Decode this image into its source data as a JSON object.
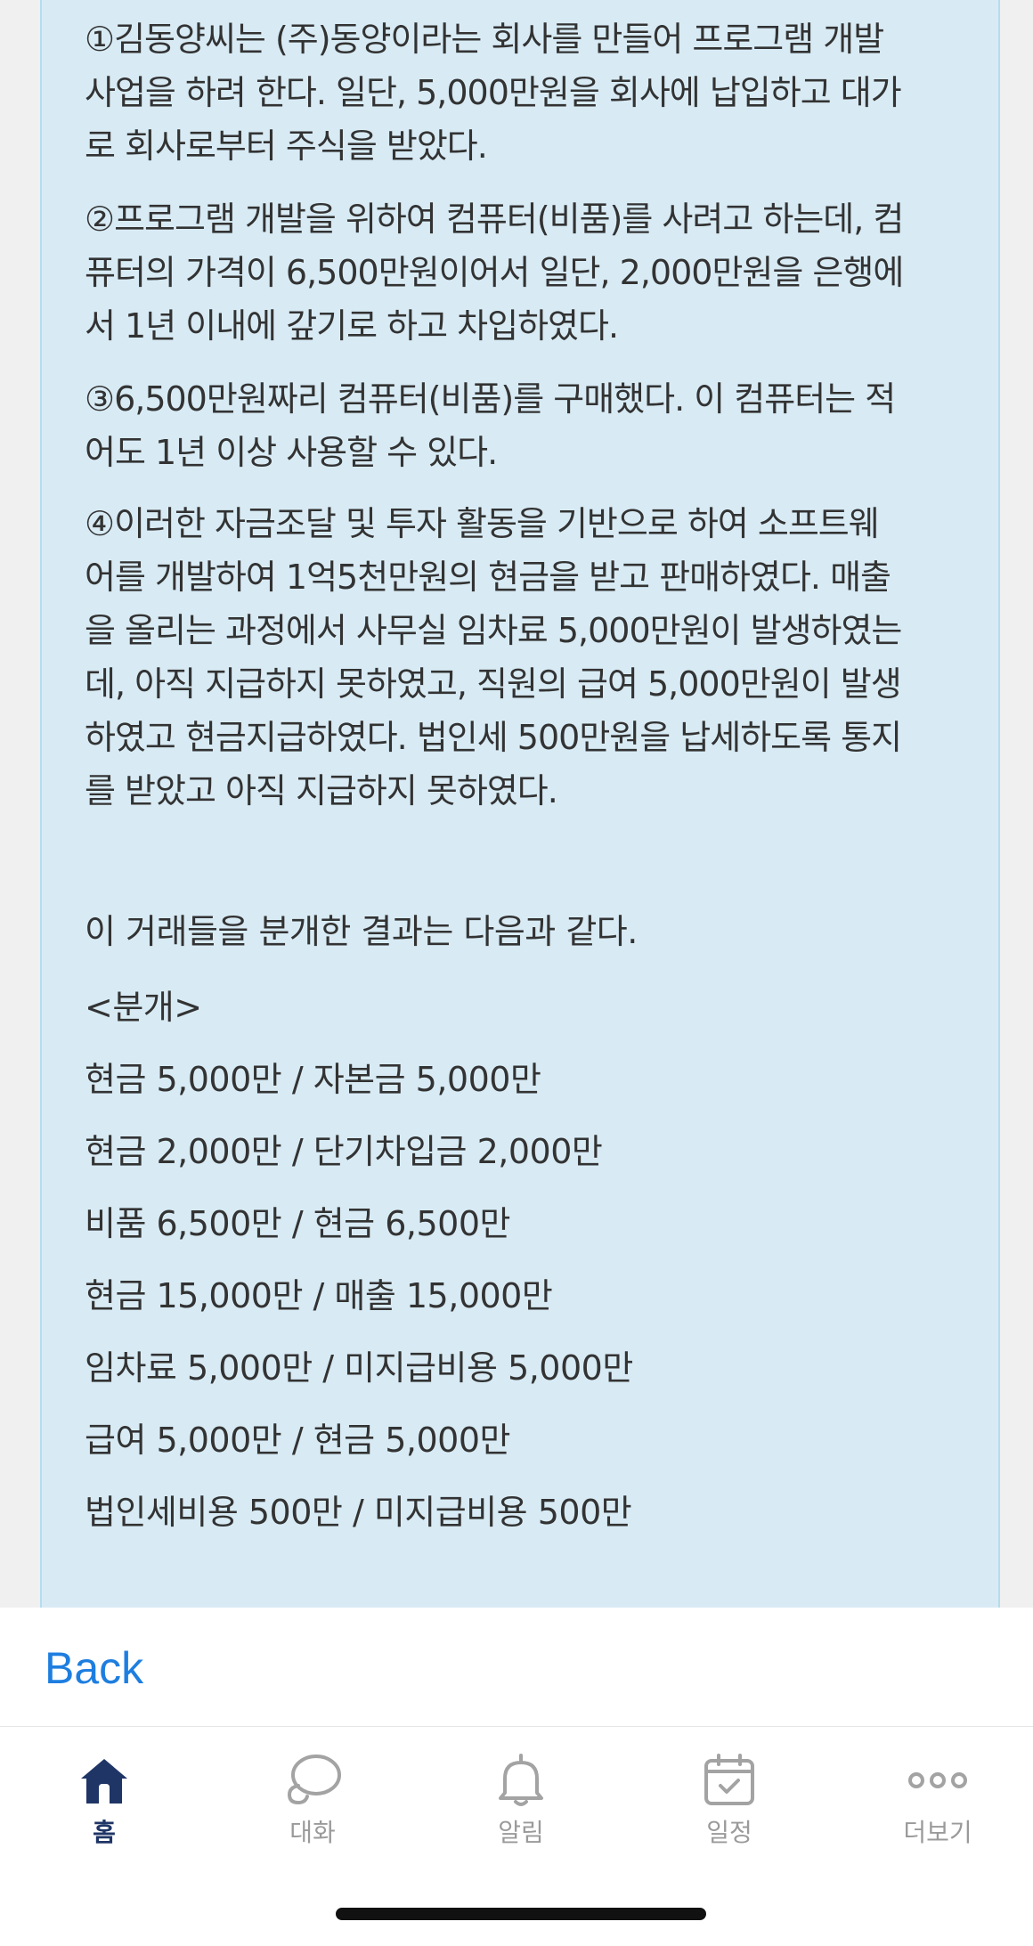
{
  "content": {
    "paragraphs": [
      "①김동양씨는 (주)동양이라는 회사를 만들어 프로그램 개발\n사업을 하려 한다. 일단, 5,000만원을 회사에 납입하고 대가\n로 회사로부터 주식을 받았다.",
      "②프로그램 개발을 위하여 컴퓨터(비품)를 사려고 하는데, 컴\n퓨터의 가격이 6,500만원이어서 일단, 2,000만원을 은행에\n서 1년 이내에 갚기로 하고 차입하였다.",
      "③6,500만원짜리 컴퓨터(비품)를 구매했다. 이 컴퓨터는 적\n어도 1년 이상 사용할 수 있다.",
      "④이러한 자금조달 및 투자 활동을 기반으로 하여 소프트웨\n어를 개발하여 1억5천만원의 현금을 받고 판매하였다. 매출\n을 올리는 과정에서 사무실 임차료 5,000만원이 발생하였는\n데, 아직 지급하지 못하였고, 직원의 급여 5,000만원이 발생\n하였고 현금지급하였다. 법인세 500만원을 납세하도록 통지\n를 받았고 아직 지급하지 못하였다."
    ],
    "summary_intro": "이 거래들을 분개한 결과는 다음과 같다.",
    "journal_heading": "<분개>",
    "journal_entries": [
      "현금 5,000만 / 자본금 5,000만",
      "현금 2,000만 / 단기차입금 2,000만",
      "비품 6,500만 / 현금 6,500만",
      "현금 15,000만 / 매출 15,000만",
      "임차료 5,000만 / 미지급비용 5,000만",
      "급여 5,000만 / 현금 5,000만",
      "법인세비용 500만 / 미지급비용 500만"
    ]
  },
  "navigation": {
    "back_label": "Back"
  },
  "tab_bar": {
    "items": [
      {
        "label": "홈",
        "icon": "home-icon",
        "active": true
      },
      {
        "label": "대화",
        "icon": "chat-bubbles-icon",
        "active": false
      },
      {
        "label": "알림",
        "icon": "bell-icon",
        "active": false
      },
      {
        "label": "일정",
        "icon": "calendar-check-icon",
        "active": false
      },
      {
        "label": "더보기",
        "icon": "more-dots-icon",
        "active": false
      }
    ]
  },
  "colors": {
    "card_background": "#d8ebf5",
    "link_blue": "#1e7ee0",
    "active_tab": "#1f3566",
    "inactive_tab": "#9a9a9a"
  }
}
